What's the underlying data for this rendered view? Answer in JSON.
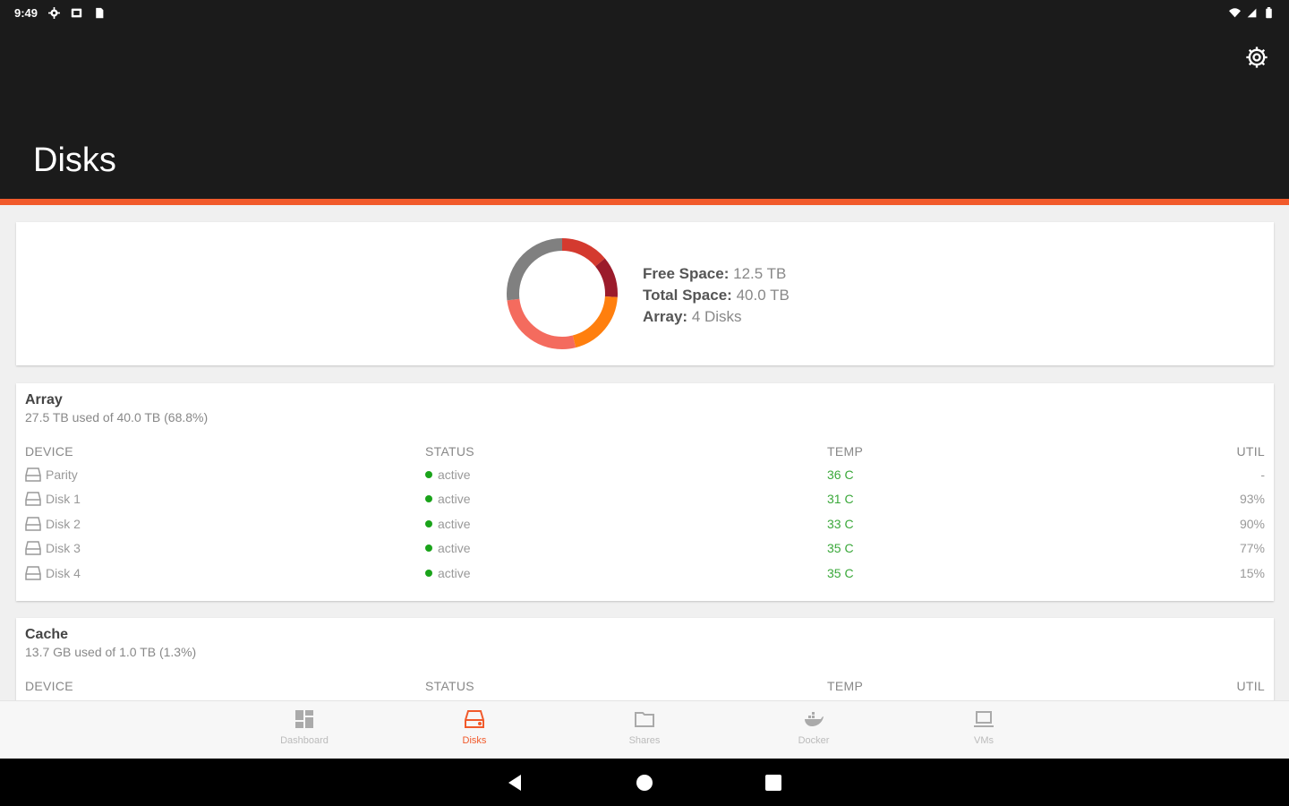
{
  "status_bar": {
    "time": "9:49"
  },
  "app_bar": {
    "title": "Disks"
  },
  "summary": {
    "free_label": "Free Space:",
    "free_value": "12.5 TB",
    "total_label": "Total Space:",
    "total_value": "40.0 TB",
    "array_label": "Array:",
    "array_value": "4 Disks",
    "colors": [
      "#d43a2f",
      "#9b1b2b",
      "#ff7f0e",
      "#f46b5e",
      "#808080"
    ]
  },
  "array": {
    "title": "Array",
    "subtitle": "27.5 TB used of 40.0 TB (68.8%)",
    "columns": {
      "device": "DEVICE",
      "status": "STATUS",
      "temp": "TEMP",
      "util": "UTIL"
    },
    "rows": [
      {
        "device": "Parity",
        "status": "active",
        "temp": "36 C",
        "util": "-"
      },
      {
        "device": "Disk 1",
        "status": "active",
        "temp": "31 C",
        "util": "93%"
      },
      {
        "device": "Disk 2",
        "status": "active",
        "temp": "33 C",
        "util": "90%"
      },
      {
        "device": "Disk 3",
        "status": "active",
        "temp": "35 C",
        "util": "77%"
      },
      {
        "device": "Disk 4",
        "status": "active",
        "temp": "35 C",
        "util": "15%"
      }
    ]
  },
  "cache": {
    "title": "Cache",
    "subtitle": "13.7 GB used of 1.0 TB (1.3%)",
    "columns": {
      "device": "DEVICE",
      "status": "STATUS",
      "temp": "TEMP",
      "util": "UTIL"
    }
  },
  "bottom_nav": [
    {
      "label": "Dashboard",
      "icon": "dashboard-icon"
    },
    {
      "label": "Disks",
      "icon": "disk-icon",
      "active": true
    },
    {
      "label": "Shares",
      "icon": "folder-icon"
    },
    {
      "label": "Docker",
      "icon": "docker-icon"
    },
    {
      "label": "VMs",
      "icon": "laptop-icon"
    }
  ]
}
